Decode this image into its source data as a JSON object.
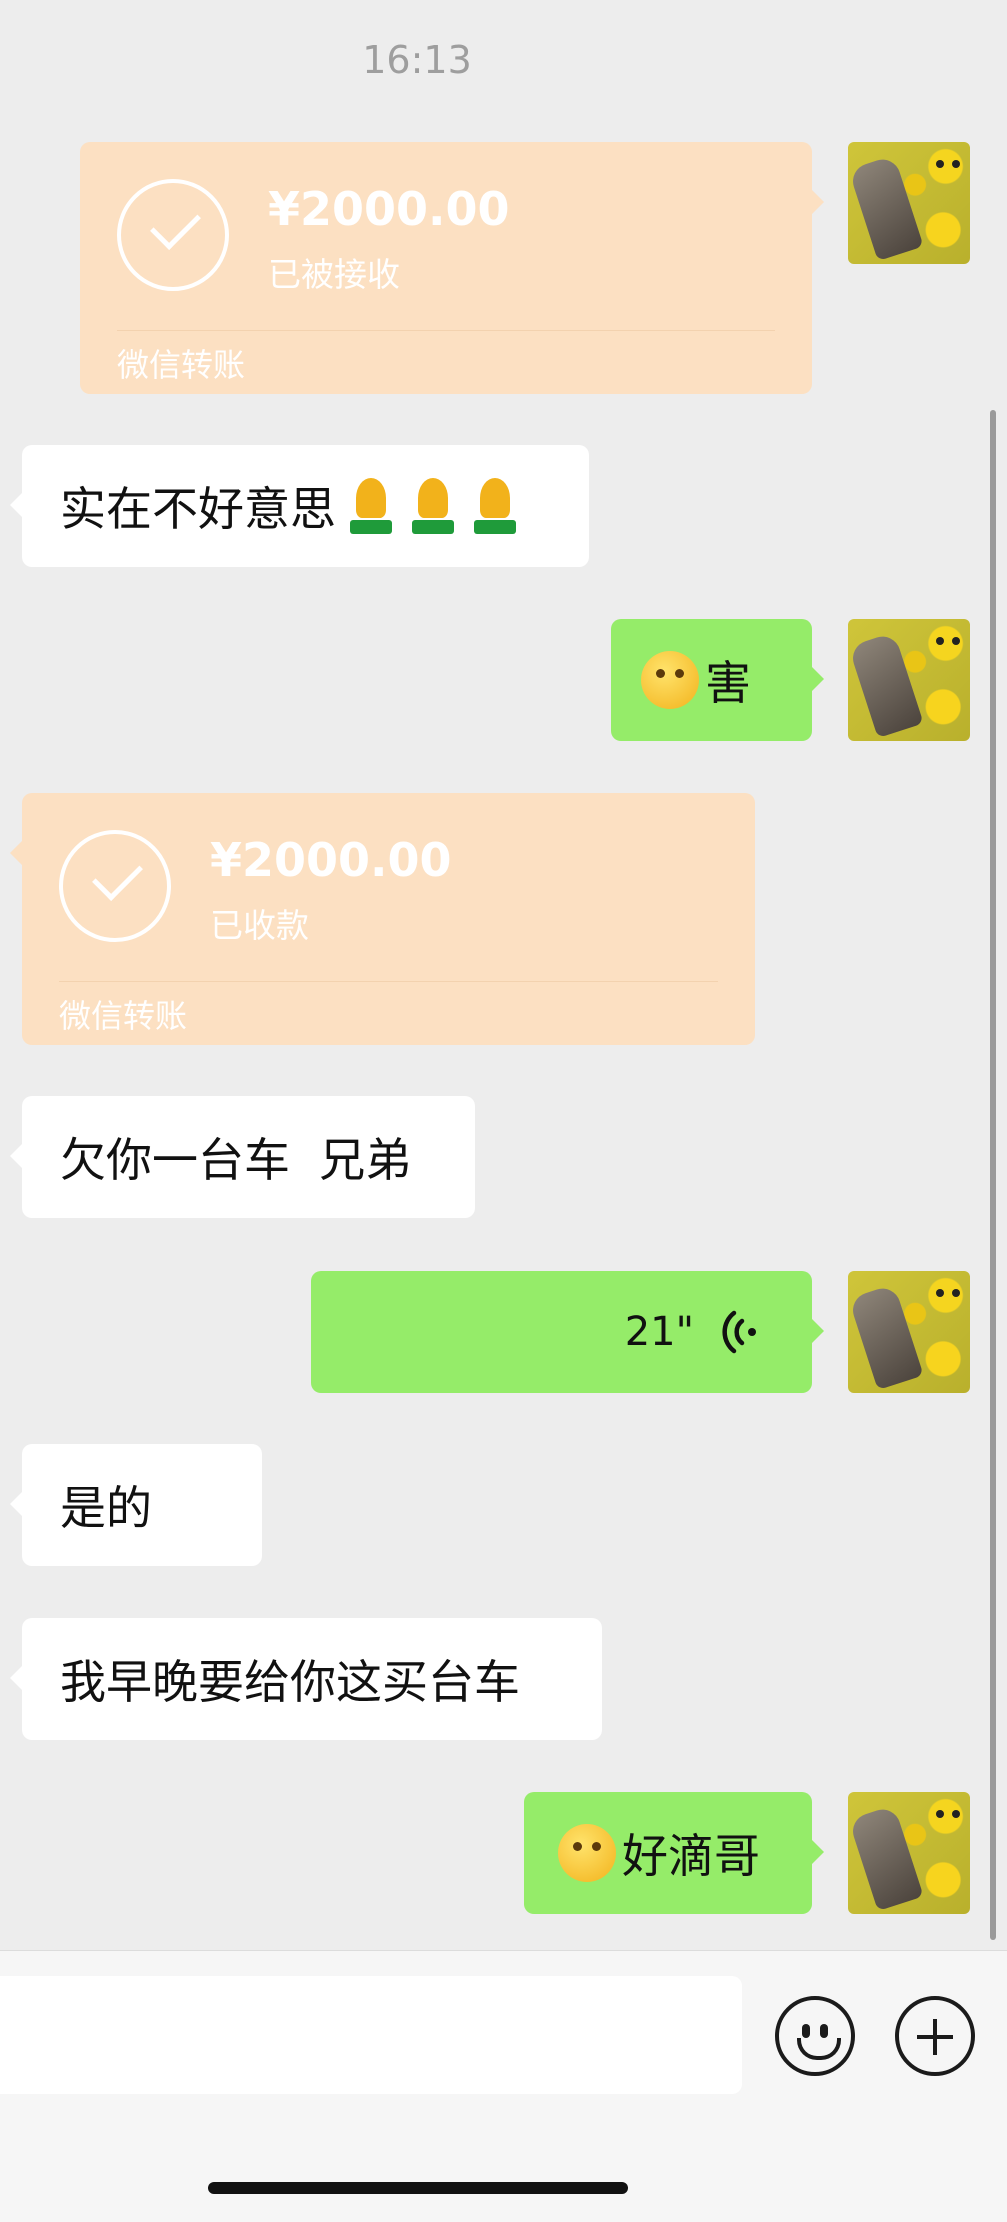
{
  "chat": {
    "timestamp": "16:13",
    "messages": [
      {
        "type": "transfer",
        "side": "right",
        "amount": "¥2000.00",
        "status": "已被接收",
        "footer": "微信转账"
      },
      {
        "type": "text",
        "side": "left",
        "text": "实在不好意思",
        "emoji": [
          "pray",
          "pray",
          "pray"
        ]
      },
      {
        "type": "text",
        "side": "right",
        "emoji": "facepalm",
        "text": "害"
      },
      {
        "type": "transfer",
        "side": "left",
        "amount": "¥2000.00",
        "status": "已收款",
        "footer": "微信转账"
      },
      {
        "type": "text",
        "side": "left",
        "text": "欠你一台车  兄弟"
      },
      {
        "type": "voice",
        "side": "right",
        "duration": "21\""
      },
      {
        "type": "text",
        "side": "left",
        "text": "是的"
      },
      {
        "type": "text",
        "side": "left",
        "text": "我早晚要给你这买台车"
      },
      {
        "type": "text",
        "side": "right",
        "emoji": "tears-of-joy",
        "text": "好滴哥"
      }
    ]
  },
  "input_bar": {
    "text": "",
    "emoji_button_icon": "smiley-icon",
    "more_button_icon": "plus-circle-icon"
  },
  "colors": {
    "background": "#EDEDED",
    "bubble_right": "#95EC69",
    "bubble_left": "#FFFFFF",
    "transfer": "#FCE0C2"
  }
}
